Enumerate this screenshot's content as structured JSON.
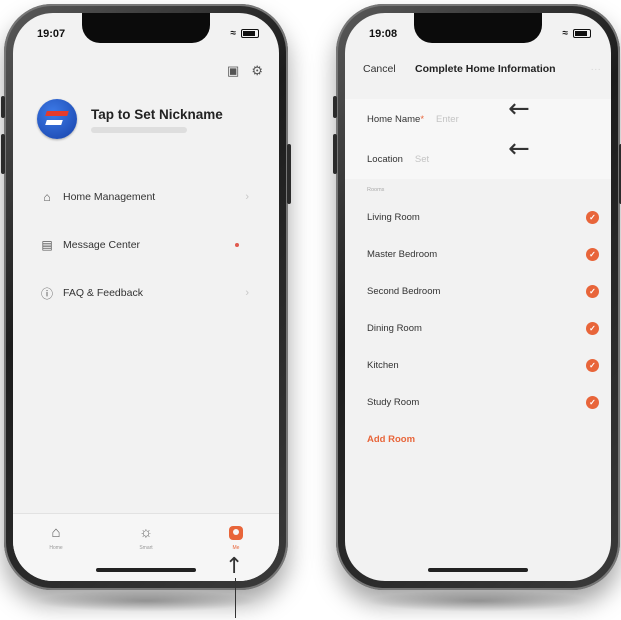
{
  "left_phone": {
    "status_time": "19:07",
    "nickname": "Tap to Set Nickname",
    "menu": [
      {
        "icon": "home-icon",
        "label": "Home Management"
      },
      {
        "icon": "message-icon",
        "label": "Message Center"
      },
      {
        "icon": "question-icon",
        "label": "FAQ & Feedback"
      }
    ],
    "tabs": [
      {
        "icon": "home-icon",
        "label": "Home"
      },
      {
        "icon": "sun-icon",
        "label": "Smart"
      },
      {
        "icon": "me-icon",
        "label": "Me"
      }
    ]
  },
  "right_phone": {
    "status_time": "19:08",
    "nav": {
      "cancel": "Cancel",
      "title": "Complete Home Information"
    },
    "form": {
      "home_name_label": "Home Name",
      "home_name_placeholder": "Enter",
      "location_label": "Location",
      "location_placeholder": "Set"
    },
    "rooms_label": "Rooms",
    "rooms": [
      "Living Room",
      "Master Bedroom",
      "Second Bedroom",
      "Dining Room",
      "Kitchen",
      "Study Room"
    ],
    "add_room": "Add Room"
  },
  "colors": {
    "accent": "#e8653a",
    "brand_blue": "#1741a8"
  }
}
